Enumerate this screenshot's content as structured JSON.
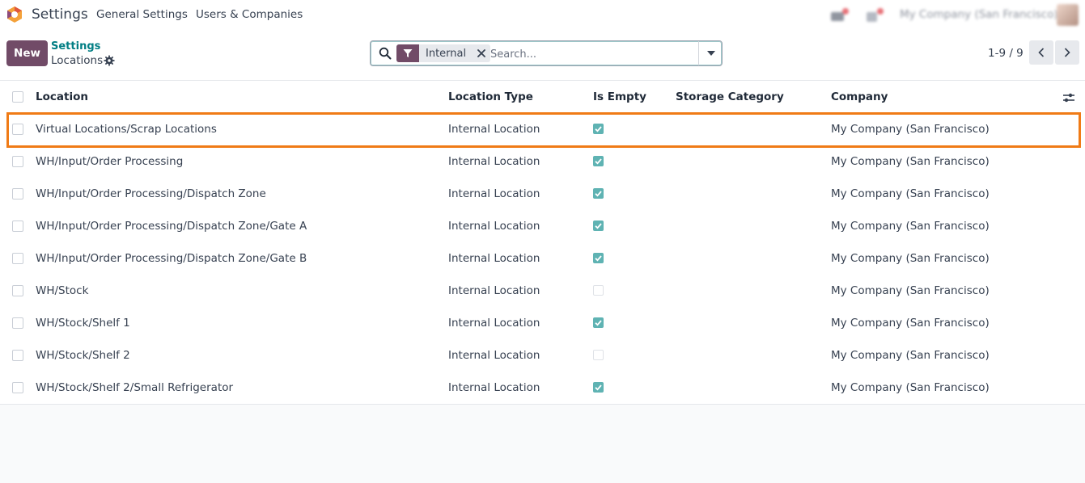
{
  "app": {
    "name": "Settings",
    "menu": [
      "General Settings",
      "Users & Companies"
    ],
    "company_switcher": "My Company (San Francisco)"
  },
  "control": {
    "new_label": "New",
    "breadcrumb_parent": "Settings",
    "breadcrumb_current": "Locations",
    "search": {
      "facet_label": "Internal",
      "placeholder": "Search..."
    },
    "pager": "1-9 / 9"
  },
  "table": {
    "columns": [
      "Location",
      "Location Type",
      "Is Empty",
      "Storage Category",
      "Company"
    ],
    "rows": [
      {
        "location": "Virtual Locations/Scrap Locations",
        "type": "Internal Location",
        "is_empty": true,
        "storage_category": "",
        "company": "My Company (San Francisco)"
      },
      {
        "location": "WH/Input/Order Processing",
        "type": "Internal Location",
        "is_empty": true,
        "storage_category": "",
        "company": "My Company (San Francisco)"
      },
      {
        "location": "WH/Input/Order Processing/Dispatch Zone",
        "type": "Internal Location",
        "is_empty": true,
        "storage_category": "",
        "company": "My Company (San Francisco)"
      },
      {
        "location": "WH/Input/Order Processing/Dispatch Zone/Gate A",
        "type": "Internal Location",
        "is_empty": true,
        "storage_category": "",
        "company": "My Company (San Francisco)"
      },
      {
        "location": "WH/Input/Order Processing/Dispatch Zone/Gate B",
        "type": "Internal Location",
        "is_empty": true,
        "storage_category": "",
        "company": "My Company (San Francisco)"
      },
      {
        "location": "WH/Stock",
        "type": "Internal Location",
        "is_empty": false,
        "storage_category": "",
        "company": "My Company (San Francisco)"
      },
      {
        "location": "WH/Stock/Shelf 1",
        "type": "Internal Location",
        "is_empty": true,
        "storage_category": "",
        "company": "My Company (San Francisco)"
      },
      {
        "location": "WH/Stock/Shelf 2",
        "type": "Internal Location",
        "is_empty": false,
        "storage_category": "",
        "company": "My Company (San Francisco)"
      },
      {
        "location": "WH/Stock/Shelf 2/Small Refrigerator",
        "type": "Internal Location",
        "is_empty": true,
        "storage_category": "",
        "company": "My Company (San Francisco)"
      }
    ]
  },
  "colors": {
    "brand": "#714b67",
    "link": "#017e84",
    "check_on": "#5fb3b3",
    "highlight": "#f07b16"
  },
  "icons": [
    "app-logo-icon",
    "chat-icon",
    "activity-icon",
    "gear-icon",
    "search-icon",
    "filter-icon",
    "close-icon",
    "caret-down-icon",
    "chevron-left-icon",
    "chevron-right-icon",
    "optional-columns-icon"
  ]
}
